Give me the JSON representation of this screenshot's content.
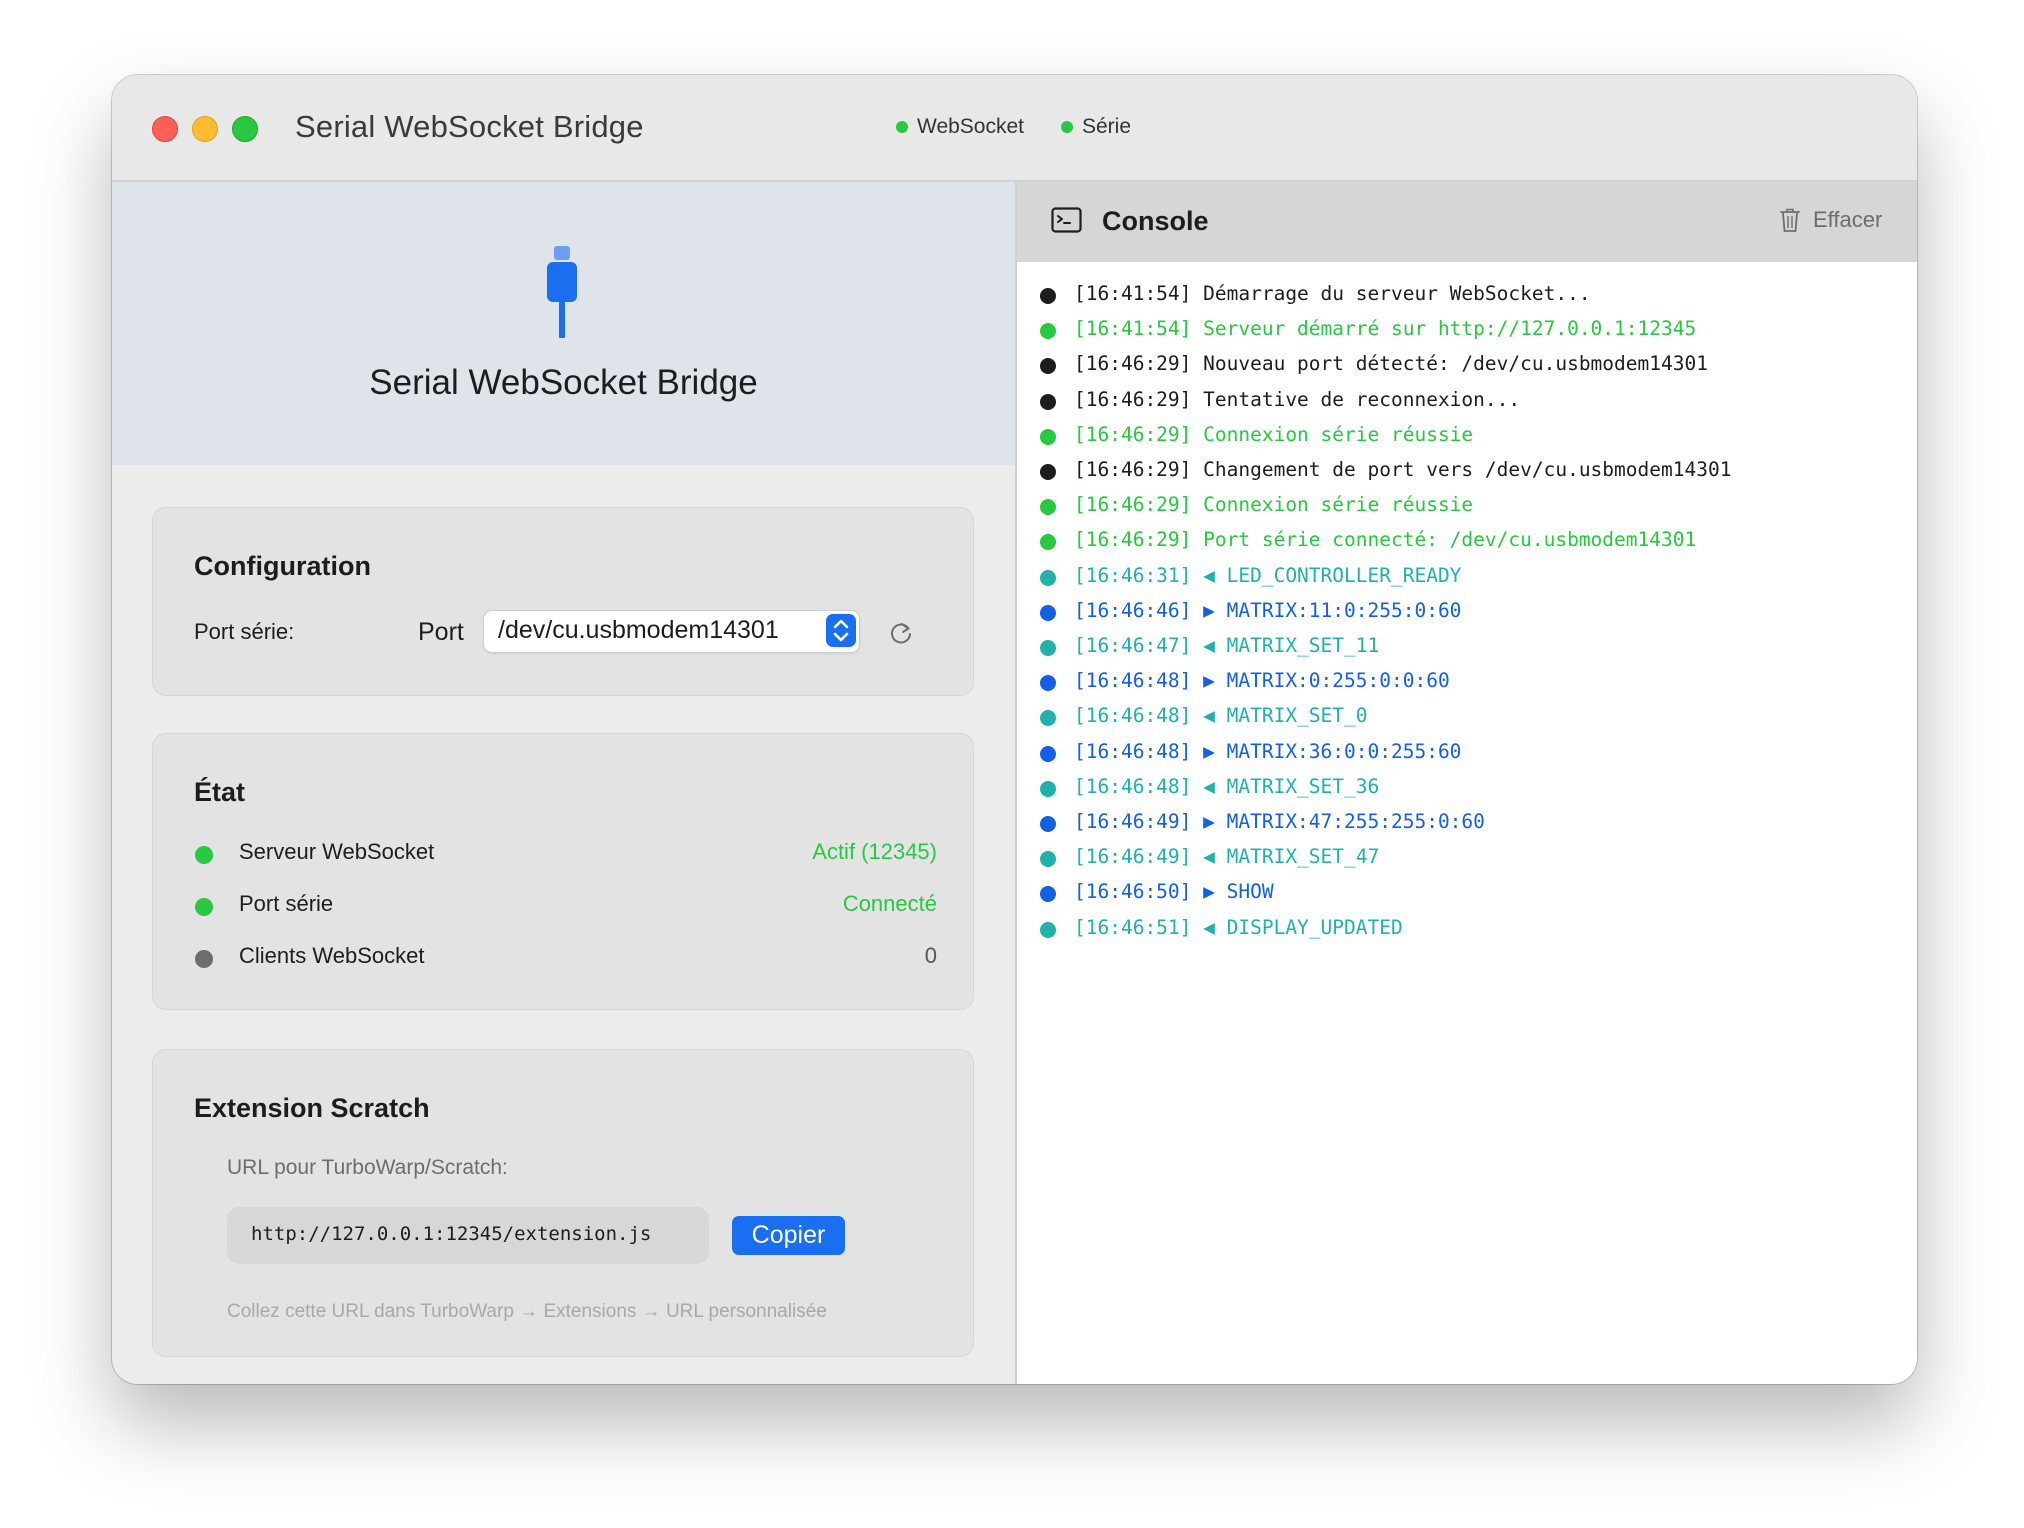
{
  "window": {
    "title": "Serial WebSocket Bridge",
    "header_status": [
      {
        "label": "WebSocket",
        "color": "#28c840"
      },
      {
        "label": "Série",
        "color": "#28c840"
      }
    ]
  },
  "hero": {
    "icon": "usb-cable-icon",
    "title": "Serial WebSocket Bridge"
  },
  "configuration": {
    "title": "Configuration",
    "port_label": "Port série:",
    "picker_label": "Port",
    "selected_port": "/dev/cu.usbmodem14301",
    "refresh_icon": "refresh-icon"
  },
  "state": {
    "title": "État",
    "rows": [
      {
        "name": "Serveur WebSocket",
        "value": "Actif (12345)",
        "dot_color": "#28c840",
        "value_color": "#28c840"
      },
      {
        "name": "Port série",
        "value": "Connecté",
        "dot_color": "#28c840",
        "value_color": "#28c840"
      },
      {
        "name": "Clients WebSocket",
        "value": "0",
        "dot_color": "#6d6d70",
        "value_color": "#555555"
      }
    ]
  },
  "extension": {
    "title": "Extension Scratch",
    "url_label": "URL pour TurboWarp/Scratch:",
    "url": "http://127.0.0.1:12345/extension.js",
    "copy_label": "Copier",
    "hint": "Collez cette URL dans TurboWarp → Extensions → URL personnalisée"
  },
  "console": {
    "title": "Console",
    "icon": "terminal-icon",
    "clear_label": "Effacer",
    "clear_icon": "trash-icon",
    "colors": {
      "info": "#1d1d1f",
      "success": "#28c840",
      "received": "#20b2aa",
      "sent": "#1360e6"
    },
    "lines": [
      {
        "text": "[16:41:54] Démarrage du serveur WebSocket...",
        "kind": "info"
      },
      {
        "text": "[16:41:54] Serveur démarré sur http://127.0.0.1:12345",
        "kind": "success"
      },
      {
        "text": "[16:46:29] Nouveau port détecté: /dev/cu.usbmodem14301",
        "kind": "info"
      },
      {
        "text": "[16:46:29] Tentative de reconnexion...",
        "kind": "info"
      },
      {
        "text": "[16:46:29] Connexion série réussie",
        "kind": "success"
      },
      {
        "text": "[16:46:29] Changement de port vers /dev/cu.usbmodem14301",
        "kind": "info"
      },
      {
        "text": "[16:46:29] Connexion série réussie",
        "kind": "success"
      },
      {
        "text": "[16:46:29] Port série connecté: /dev/cu.usbmodem14301",
        "kind": "success"
      },
      {
        "text": "[16:46:31] ◀ LED_CONTROLLER_READY",
        "kind": "received"
      },
      {
        "text": "[16:46:46] ▶ MATRIX:11:0:255:0:60",
        "kind": "sent"
      },
      {
        "text": "[16:46:47] ◀ MATRIX_SET_11",
        "kind": "received"
      },
      {
        "text": "[16:46:48] ▶ MATRIX:0:255:0:0:60",
        "kind": "sent"
      },
      {
        "text": "[16:46:48] ◀ MATRIX_SET_0",
        "kind": "received"
      },
      {
        "text": "[16:46:48] ▶ MATRIX:36:0:0:255:60",
        "kind": "sent"
      },
      {
        "text": "[16:46:48] ◀ MATRIX_SET_36",
        "kind": "received"
      },
      {
        "text": "[16:46:49] ▶ MATRIX:47:255:255:0:60",
        "kind": "sent"
      },
      {
        "text": "[16:46:49] ◀ MATRIX_SET_47",
        "kind": "received"
      },
      {
        "text": "[16:46:50] ▶ SHOW",
        "kind": "sent"
      },
      {
        "text": "[16:46:51] ◀ DISPLAY_UPDATED",
        "kind": "received"
      }
    ]
  }
}
